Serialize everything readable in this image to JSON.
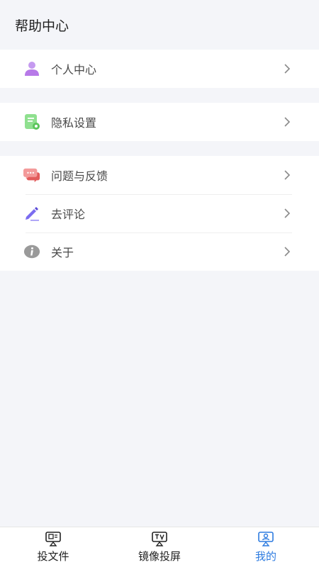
{
  "header": {
    "title": "帮助中心"
  },
  "groups": [
    {
      "items": [
        {
          "label": "个人中心",
          "icon": "user-icon"
        }
      ]
    },
    {
      "items": [
        {
          "label": "隐私设置",
          "icon": "privacy-settings-icon"
        }
      ]
    },
    {
      "items": [
        {
          "label": "问题与反馈",
          "icon": "chat-bubbles-icon"
        },
        {
          "label": "去评论",
          "icon": "pencil-icon"
        },
        {
          "label": "关于",
          "icon": "info-icon"
        }
      ]
    }
  ],
  "tabbar": {
    "tabs": [
      {
        "label": "投文件",
        "icon": "cast-file-icon",
        "active": false
      },
      {
        "label": "镜像投屏",
        "icon": "tv-mirror-icon",
        "active": false
      },
      {
        "label": "我的",
        "icon": "profile-icon",
        "active": true
      }
    ]
  },
  "colors": {
    "background": "#f4f5f9",
    "active_tab": "#2d7be0",
    "user_icon": "#b779e8",
    "privacy_icon": "#7ad67a",
    "chat_icon": "#ef7c7c",
    "pencil_icon": "#7b6cf0",
    "info_icon": "#8d8d8d"
  }
}
